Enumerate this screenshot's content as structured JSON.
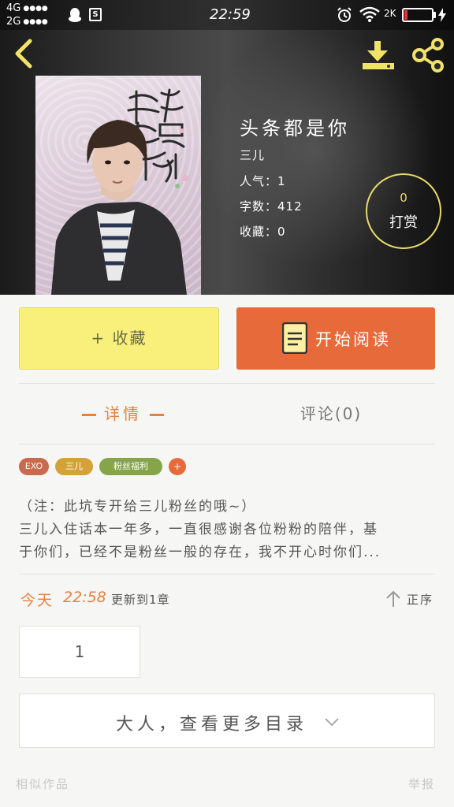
{
  "status_bar": {
    "network_1": "4G",
    "network_2": "2G",
    "signal_dots": "●●●●",
    "time": "22:59",
    "speed": "2K",
    "battery_fraction": 0.12,
    "battery_color": "#e33333"
  },
  "header": {
    "back_icon": "chevron-left-icon",
    "download_icon": "download-icon",
    "share_icon": "share-icon"
  },
  "book": {
    "title": "头条都是你",
    "author": "三儿",
    "popularity": "人气：1",
    "word_count": "字数：412",
    "favorites": "收藏：0",
    "reward_count": "0",
    "reward_label": "打赏"
  },
  "actions": {
    "favorite_label": "+ 收藏",
    "read_label": "开始阅读",
    "read_icon": "book-icon"
  },
  "tabs": {
    "details": "详情",
    "comments": "评论(0)"
  },
  "tags": [
    "EXO",
    "三儿",
    "粉丝福利"
  ],
  "tags_more": "+",
  "description": {
    "line1": "（注：此坑专开给三儿粉丝的哦~）",
    "line2": "三儿入住话本一年多，一直很感谢各位粉粉的陪伴，基",
    "line3": "于你们，已经不是粉丝一般的存在，我不开心时你们..."
  },
  "update": {
    "day": "今天",
    "time": "22:58",
    "text": "更新到1章",
    "sort_label": "正序"
  },
  "chapter": {
    "number": "1"
  },
  "catalog": {
    "label": "大人，查看更多目录"
  },
  "footer": {
    "similar": "相似作品",
    "report": "举报"
  },
  "colors": {
    "accent_orange": "#e8813e",
    "read_button": "#e76a3a",
    "favorite_button": "#f8f07a",
    "reward_ring": "#e9d96a"
  }
}
